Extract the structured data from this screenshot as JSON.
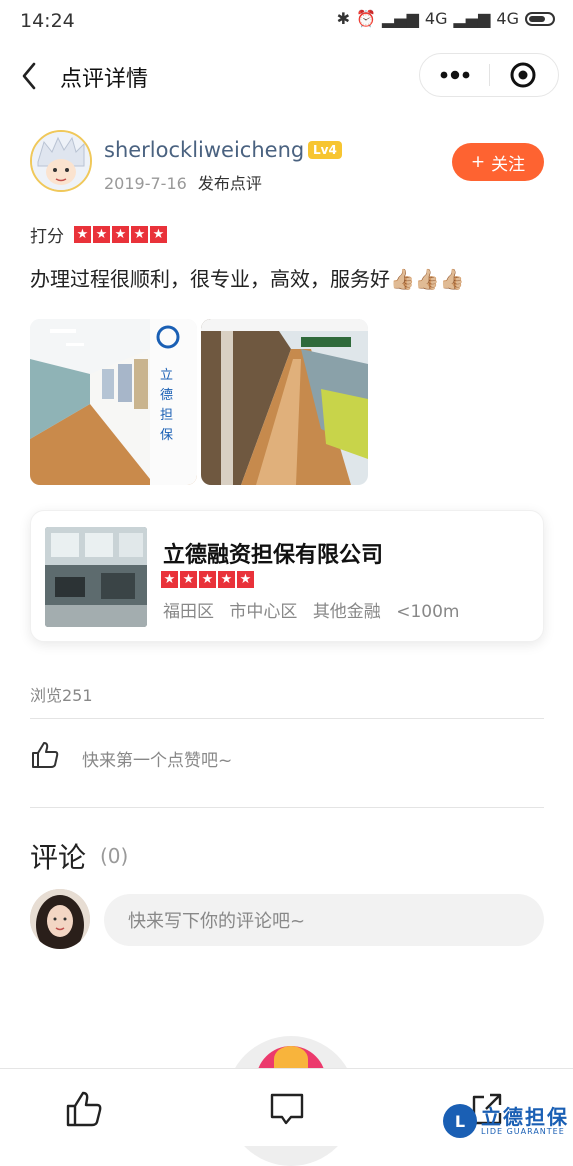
{
  "status_bar": {
    "time": "14:24",
    "network": "4G",
    "network2": "4G"
  },
  "nav": {
    "title": "点评详情"
  },
  "author": {
    "username": "sherlockliweicheng",
    "level": "Lv4",
    "date": "2019-7-16",
    "action": "发布点评",
    "follow_label": "关注",
    "follow_symbol": "+"
  },
  "review": {
    "score_label": "打分",
    "rating": 5,
    "text": "办理过程很顺利，很专业，高效，服务好👍🏼👍🏼👍🏼"
  },
  "shop": {
    "name": "立德融资担保有限公司",
    "rating": 5,
    "district": "福田区",
    "area": "市中心区",
    "category": "其他金融",
    "distance": "<100m"
  },
  "views": "浏览251",
  "likes": {
    "prompt": "快来第一个点赞吧~"
  },
  "comments": {
    "title": "评论",
    "count": "(0)",
    "placeholder": "快来写下你的评论吧~"
  },
  "watermark": {
    "logo": "L",
    "text_cn": "立德担保",
    "text_en": "LIDE GUARANTEE"
  },
  "icons": {
    "back": "chevron-left-icon",
    "more": "more-dots-icon",
    "close": "record-circle-icon",
    "like": "thumbs-up-icon",
    "comment": "comment-bubble-icon",
    "share": "share-icon"
  },
  "colors": {
    "accent": "#fe6331",
    "star": "#e9323a",
    "level_badge": "#f7c531",
    "username": "#4a6280"
  }
}
